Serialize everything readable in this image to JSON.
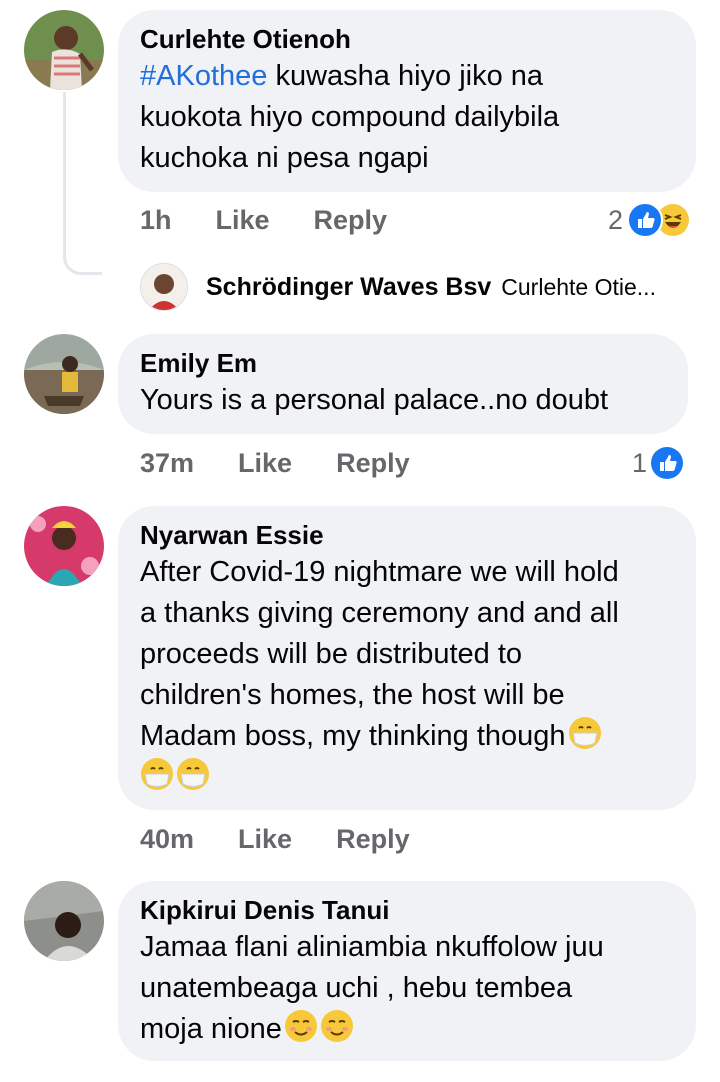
{
  "actions": {
    "like": "Like",
    "reply": "Reply"
  },
  "comments": [
    {
      "author": "Curlehte Otienoh",
      "hashtag": "#AKothee",
      "lines": [
        " kuwasha hiyo jiko na",
        "kuokota hiyo compound dailybila",
        "kuchoka ni pesa ngapi"
      ],
      "time": "1h",
      "reaction_count": "2",
      "reactions": [
        "like",
        "haha"
      ],
      "reply_preview": {
        "author": "Schrödinger Waves Bsv",
        "text": "Curlehte Otie..."
      }
    },
    {
      "author": "Emily Em",
      "lines": [
        "Yours is a personal palace..no doubt"
      ],
      "time": "37m",
      "reaction_count": "1",
      "reactions": [
        "like"
      ]
    },
    {
      "author": "Nyarwan Essie",
      "lines": [
        "After Covid-19 nightmare we will hold",
        "a thanks giving ceremony and and all",
        "proceeds will be distributed to",
        "children's homes, the host will be",
        "Madam boss, my thinking though"
      ],
      "time": "40m",
      "emoji": "mask-face-emoji"
    },
    {
      "author": "Kipkirui Denis Tanui",
      "lines": [
        " Jamaa flani aliniambia nkuffolow juu",
        "unatembeaga uchi ,  hebu tembea",
        "moja nione"
      ],
      "emoji": "smirk-face-emoji"
    }
  ],
  "colors": {
    "like_blue": "#1877f2",
    "hashtag": "#216fdb",
    "meta_gray": "#65676b",
    "bubble": "#f0f2f5"
  }
}
